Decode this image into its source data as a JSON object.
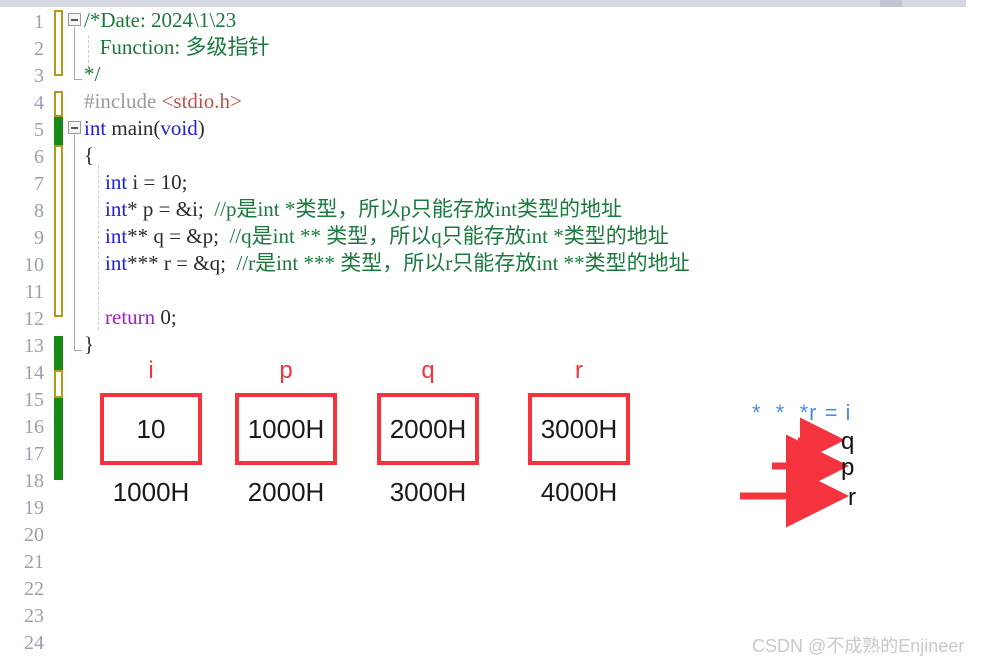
{
  "editor": {
    "line_numbers": [
      "1",
      "2",
      "3",
      "4",
      "5",
      "6",
      "7",
      "8",
      "9",
      "10",
      "11",
      "12",
      "13",
      "14",
      "15",
      "16",
      "17",
      "18",
      "19",
      "20",
      "21",
      "22",
      "23",
      "24"
    ],
    "lines": [
      {
        "n": 1,
        "segments": [
          {
            "t": "/*Date: 2024\\1\\23",
            "c": "comment"
          }
        ]
      },
      {
        "n": 2,
        "segments": [
          {
            "t": "   Function: 多级指针",
            "c": "comment"
          }
        ]
      },
      {
        "n": 3,
        "segments": [
          {
            "t": "*/",
            "c": "comment"
          }
        ]
      },
      {
        "n": 4,
        "segments": [
          {
            "t": "#include ",
            "c": "pre"
          },
          {
            "t": "<stdio.h>",
            "c": "header"
          }
        ]
      },
      {
        "n": 5,
        "segments": [
          {
            "t": "int ",
            "c": "keyword"
          },
          {
            "t": "main(",
            "c": "plain"
          },
          {
            "t": "void",
            "c": "keyword"
          },
          {
            "t": ")",
            "c": "plain"
          }
        ]
      },
      {
        "n": 6,
        "segments": [
          {
            "t": "{",
            "c": "plain"
          }
        ]
      },
      {
        "n": 7,
        "segments": [
          {
            "t": "    ",
            "c": "plain"
          },
          {
            "t": "int",
            "c": "keyword"
          },
          {
            "t": " i = 10;",
            "c": "plain"
          }
        ]
      },
      {
        "n": 8,
        "segments": [
          {
            "t": "    ",
            "c": "plain"
          },
          {
            "t": "int",
            "c": "keyword"
          },
          {
            "t": "* p = &i;  ",
            "c": "plain"
          },
          {
            "t": "//p是int *类型，所以p只能存放int类型的地址",
            "c": "comment"
          }
        ]
      },
      {
        "n": 9,
        "segments": [
          {
            "t": "    ",
            "c": "plain"
          },
          {
            "t": "int",
            "c": "keyword"
          },
          {
            "t": "** q = &p;  ",
            "c": "plain"
          },
          {
            "t": "//q是int ** 类型，所以q只能存放int *类型的地址",
            "c": "comment"
          }
        ]
      },
      {
        "n": 10,
        "segments": [
          {
            "t": "    ",
            "c": "plain"
          },
          {
            "t": "int",
            "c": "keyword"
          },
          {
            "t": "*** r = &q;  ",
            "c": "plain"
          },
          {
            "t": "//r是int *** 类型，所以r只能存放int **类型的地址",
            "c": "comment"
          }
        ]
      },
      {
        "n": 11,
        "segments": []
      },
      {
        "n": 12,
        "segments": [
          {
            "t": "    ",
            "c": "plain"
          },
          {
            "t": "return",
            "c": "return"
          },
          {
            "t": " 0;",
            "c": "plain"
          }
        ]
      },
      {
        "n": 13,
        "segments": [
          {
            "t": "}",
            "c": "plain"
          }
        ]
      }
    ],
    "fold_markers": [
      "fold-comment-block",
      "fold-main-function"
    ],
    "change_bars": [
      {
        "kind": "modified",
        "from_line": 1,
        "to_line": 3
      },
      {
        "kind": "modified",
        "from_line": 4,
        "to_line": 4
      },
      {
        "kind": "added",
        "from_line": 5,
        "to_line": 5
      },
      {
        "kind": "modified",
        "from_line": 6,
        "to_line": 12
      },
      {
        "kind": "added",
        "from_line": 13,
        "to_line": 13
      },
      {
        "kind": "modified",
        "from_line": 14,
        "to_line": 14
      },
      {
        "kind": "added",
        "from_line": 15,
        "to_line": 17
      }
    ]
  },
  "diagram": {
    "title_hint": "multi-level pointer memory layout",
    "cells": [
      {
        "name": "i",
        "value": "10",
        "address": "1000H"
      },
      {
        "name": "p",
        "value": "1000H",
        "address": "2000H"
      },
      {
        "name": "q",
        "value": "2000H",
        "address": "3000H"
      },
      {
        "name": "r",
        "value": "3000H",
        "address": "4000H"
      }
    ],
    "deref_expression": "*  *  *r = i",
    "arrows": [
      {
        "label": "q",
        "length": 52
      },
      {
        "label": "p",
        "length": 102
      },
      {
        "label": "r",
        "length": 160
      }
    ]
  },
  "watermark": {
    "text": "CSDN @不成熟的Enjineer"
  },
  "colors": {
    "accent_red": "#f5333f",
    "comment_green": "#1a7a3c",
    "keyword_blue": "#2020d8",
    "return_purple": "#a020c0",
    "header_red": "#c0504d",
    "annotation_blue": "#4a90e2",
    "changebar_modified": "#b59a16",
    "changebar_added": "#1a8a18",
    "linenumber_gray": "#9aa0b0",
    "watermark_gray": "#c9c9c9"
  }
}
